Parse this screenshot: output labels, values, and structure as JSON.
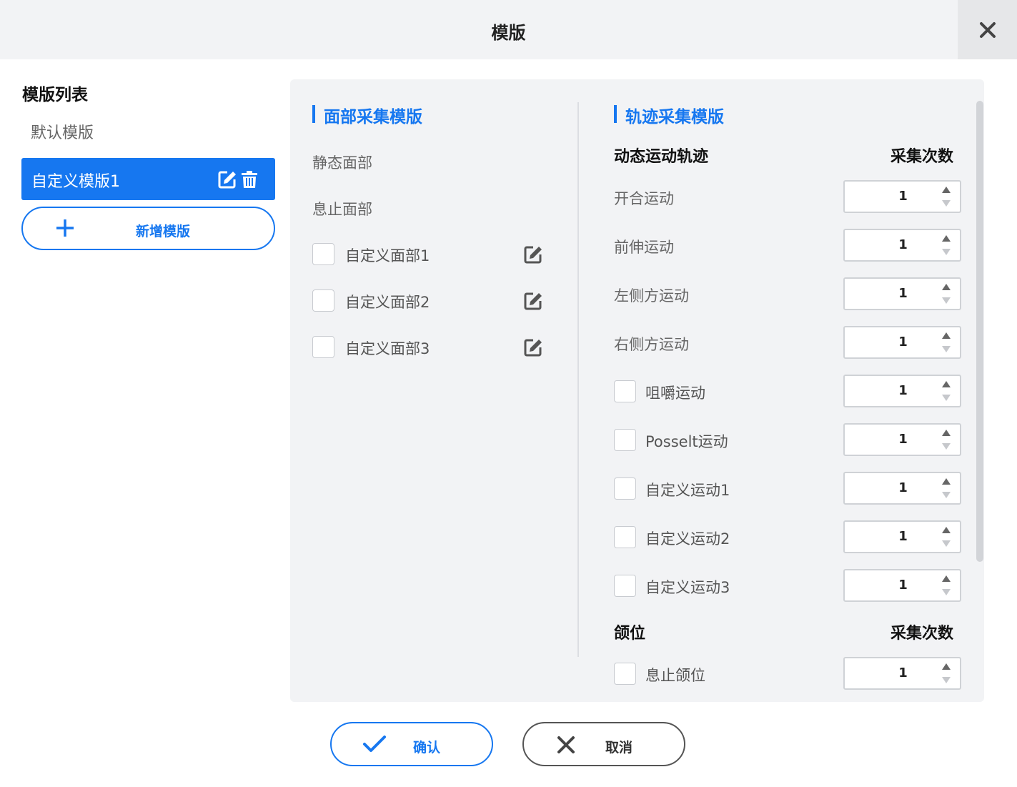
{
  "window": {
    "title": "模版"
  },
  "sidebar": {
    "title": "模版列表",
    "templates": [
      {
        "label": "默认模版",
        "selected": false
      },
      {
        "label": "自定义模版1",
        "selected": true
      }
    ],
    "add_label": "新增模版"
  },
  "face_section": {
    "title": "面部采集模版",
    "fixed_items": [
      "静态面部",
      "息止面部"
    ],
    "custom_items": [
      {
        "label": "自定义面部1",
        "checked": false
      },
      {
        "label": "自定义面部2",
        "checked": false
      },
      {
        "label": "自定义面部3",
        "checked": false
      }
    ]
  },
  "trajectory_section": {
    "title": "轨迹采集模版",
    "dynamic_group": {
      "title": "动态运动轨迹",
      "count_header": "采集次数",
      "items": [
        {
          "label": "开合运动",
          "checkbox": false,
          "count": "1"
        },
        {
          "label": "前伸运动",
          "checkbox": false,
          "count": "1"
        },
        {
          "label": "左侧方运动",
          "checkbox": false,
          "count": "1"
        },
        {
          "label": "右侧方运动",
          "checkbox": false,
          "count": "1"
        },
        {
          "label": "咀嚼运动",
          "checkbox": true,
          "checked": false,
          "count": "1"
        },
        {
          "label": "Posselt运动",
          "checkbox": true,
          "checked": false,
          "count": "1"
        },
        {
          "label": "自定义运动1",
          "checkbox": true,
          "checked": false,
          "count": "1"
        },
        {
          "label": "自定义运动2",
          "checkbox": true,
          "checked": false,
          "count": "1"
        },
        {
          "label": "自定义运动3",
          "checkbox": true,
          "checked": false,
          "count": "1"
        }
      ]
    },
    "jaw_group": {
      "title": "颌位",
      "count_header": "采集次数",
      "items": [
        {
          "label": "息止颌位",
          "checkbox": true,
          "checked": false,
          "count": "1"
        }
      ]
    }
  },
  "footer": {
    "confirm_label": "确认",
    "cancel_label": "取消"
  },
  "colors": {
    "accent": "#1677f0",
    "panel_bg": "#f2f3f5",
    "titlebar_bg": "#f2f3f5"
  }
}
